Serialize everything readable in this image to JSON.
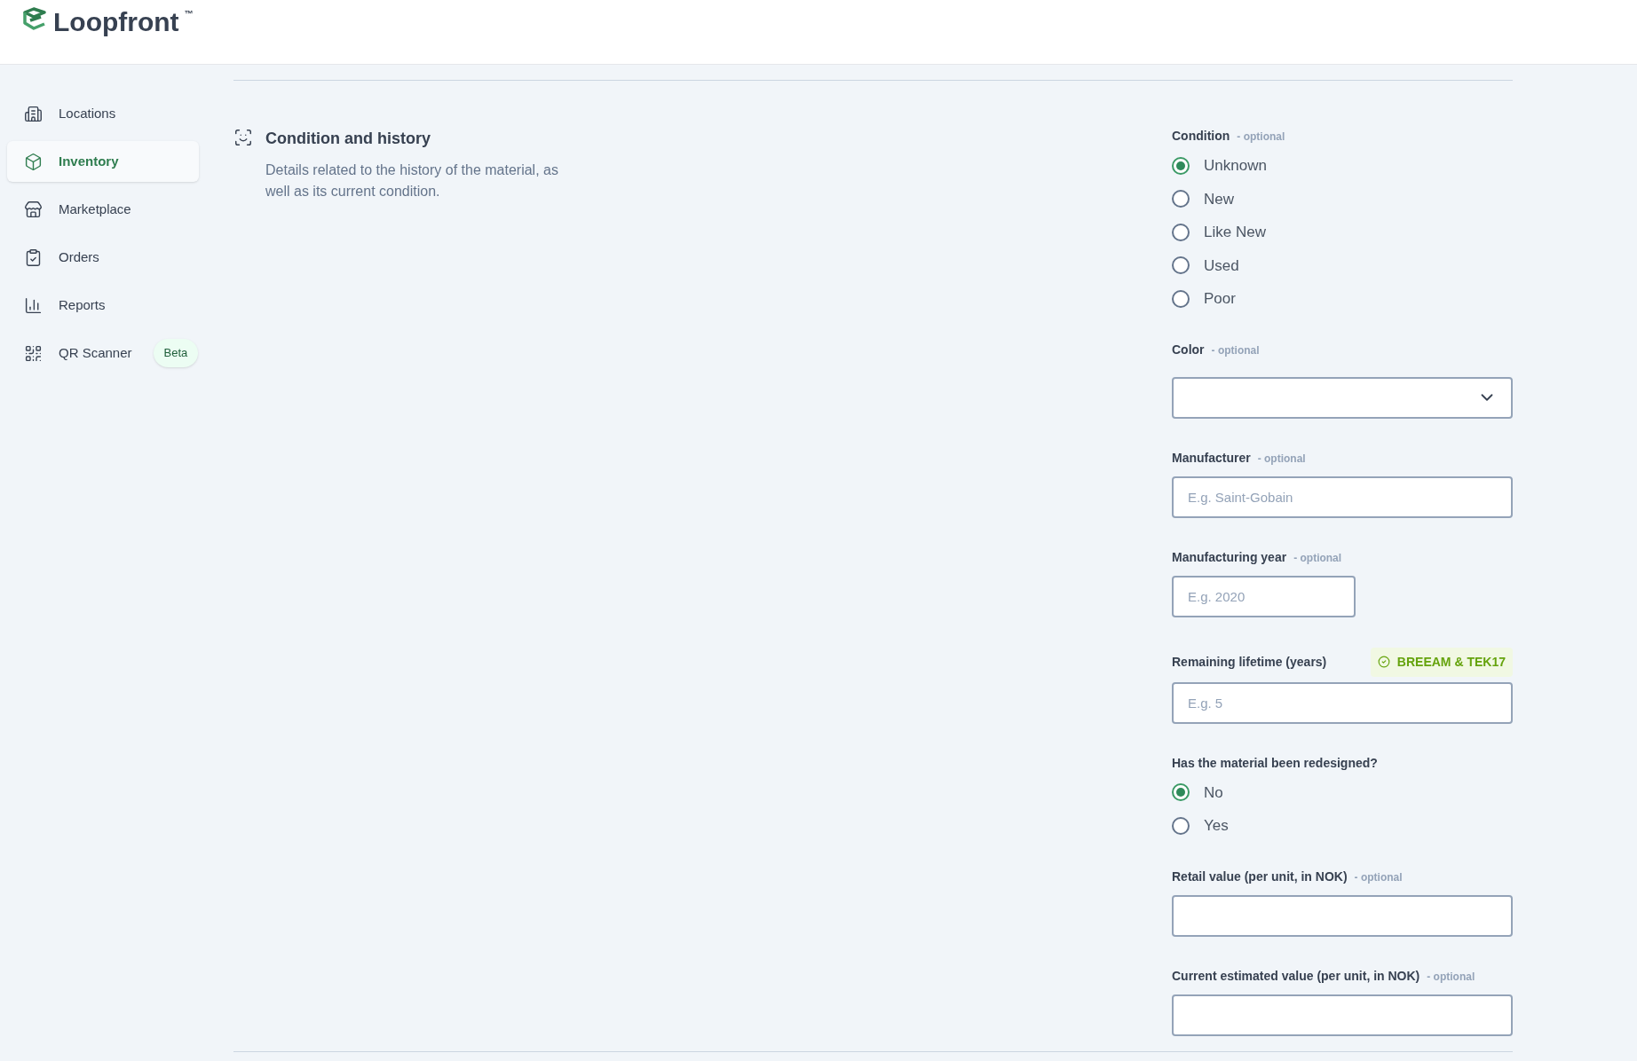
{
  "header": {
    "brand": "Loopfront",
    "trademark": "™"
  },
  "sidebar": {
    "items": [
      {
        "label": "Locations",
        "selected": false
      },
      {
        "label": "Inventory",
        "selected": true
      },
      {
        "label": "Marketplace",
        "selected": false
      },
      {
        "label": "Orders",
        "selected": false
      },
      {
        "label": "Reports",
        "selected": false
      },
      {
        "label": "QR Scanner",
        "selected": false,
        "badge": "Beta"
      }
    ]
  },
  "section": {
    "title": "Condition and history",
    "description": "Details related to the history of the material, as well as its current condition."
  },
  "fields": [
    {
      "kind": "radio",
      "label": "Condition",
      "optional": "- optional",
      "options": [
        {
          "label": "Unknown",
          "selected": true
        },
        {
          "label": "New",
          "selected": false
        },
        {
          "label": "Like New",
          "selected": false
        },
        {
          "label": "Used",
          "selected": false
        },
        {
          "label": "Poor",
          "selected": false
        }
      ]
    },
    {
      "kind": "select",
      "label": "Color",
      "optional": "- optional"
    },
    {
      "kind": "text",
      "label": "Manufacturer",
      "optional": "- optional",
      "placeholder": "E.g. Saint-Gobain"
    },
    {
      "kind": "short_text",
      "label": "Manufacturing year",
      "optional": "- optional",
      "placeholder": "E.g. 2020"
    },
    {
      "kind": "text",
      "label": "Remaining lifetime (years)",
      "badge": "BREEAM & TEK17",
      "placeholder": "E.g. 5"
    },
    {
      "kind": "radio",
      "label": "Has the material been redesigned?",
      "options": [
        {
          "label": "No",
          "selected": true
        },
        {
          "label": "Yes",
          "selected": false
        }
      ]
    },
    {
      "kind": "text",
      "label": "Retail value (per unit, in NOK)",
      "optional": "- optional"
    },
    {
      "kind": "text",
      "label": "Current estimated value (per unit, in NOK)",
      "optional": "- optional"
    }
  ]
}
